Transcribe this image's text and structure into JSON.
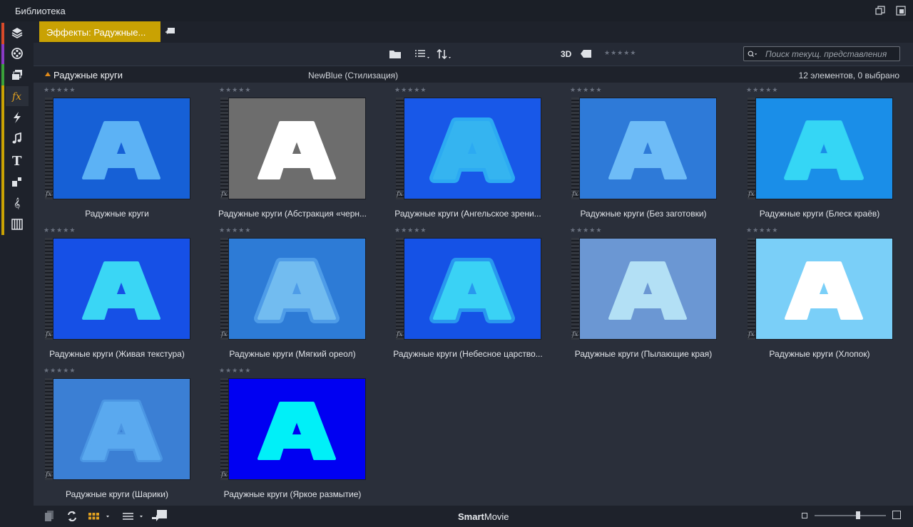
{
  "window": {
    "title": "Библиотека"
  },
  "tabs": {
    "active_label": "Эффекты: Радужные..."
  },
  "toolbar": {
    "label_3d": "3D",
    "search_placeholder": "Поиск текущ. представления"
  },
  "header": {
    "folder_name": "Радужные круги",
    "category": "NewBlue (Стилизация)",
    "count": "12 элементов, 0 выбрано"
  },
  "items": [
    {
      "label": "Радужные круги",
      "bg": "#1660d6",
      "letter": "#5cb2f5",
      "stroke": "#5cb2f5",
      "glow": "none",
      "rating": 0
    },
    {
      "label": "Радужные круги (Абстракция «черн...",
      "bg": "#6d6d6d",
      "letter": "#ffffff",
      "stroke": "#ffffff",
      "glow": "none",
      "rating": 0
    },
    {
      "label": "Радужные круги (Ангельское зрени...",
      "bg": "#1858e8",
      "letter": "#35b4f0",
      "stroke": "#33c6f5",
      "glow": "outline",
      "rating": 0
    },
    {
      "label": "Радужные круги (Без заготовки)",
      "bg": "#2e7ad8",
      "letter": "#6ebcf7",
      "stroke": "#6ebcf7",
      "glow": "none",
      "rating": 0
    },
    {
      "label": "Радужные круги (Блеск краёв)",
      "bg": "#1a8ee8",
      "letter": "#35d6f5",
      "stroke": "#35d6f5",
      "glow": "edge",
      "rating": 0
    },
    {
      "label": "Радужные круги (Живая текстура)",
      "bg": "#1650e6",
      "letter": "#3ad6f5",
      "stroke": "#3ad6f5",
      "glow": "none",
      "rating": 0
    },
    {
      "label": "Радужные круги (Мягкий ореол)",
      "bg": "#2d7bd6",
      "letter": "#72bcf0",
      "stroke": "#5aa7ee",
      "glow": "outline",
      "rating": 0
    },
    {
      "label": "Радужные круги (Небесное царство...",
      "bg": "#1552e6",
      "letter": "#3ad2f5",
      "stroke": "#2fb0f2",
      "glow": "outline",
      "rating": 0
    },
    {
      "label": "Радужные круги (Пылающие края)",
      "bg": "#6b97d3",
      "letter": "#b3e0f5",
      "stroke": "#b3e0f5",
      "glow": "none",
      "rating": 0
    },
    {
      "label": "Радужные круги (Хлопок)",
      "bg": "#7acff8",
      "letter": "#ffffff",
      "stroke": "#ffffff",
      "glow": "none",
      "rating": 0
    },
    {
      "label": "Радужные круги (Шарики)",
      "bg": "#3b7fd4",
      "letter": "#5aa9ef",
      "stroke": "#5aa9ef",
      "glow": "soft",
      "rating": 0
    },
    {
      "label": "Радужные круги (Яркое размытие)",
      "bg": "#0000f2",
      "letter": "#00f0f8",
      "stroke": "#00f0f8",
      "glow": "none",
      "rating": 0
    }
  ],
  "bottombar": {
    "brand_bold": "Smart",
    "brand_rest": "Movie",
    "zoom_level": 0.62
  },
  "colors": {
    "accent": "#c9a203",
    "stripes": [
      "#d84a2a",
      "#8a3bc4",
      "#3aa13a",
      "#c9a203"
    ]
  }
}
